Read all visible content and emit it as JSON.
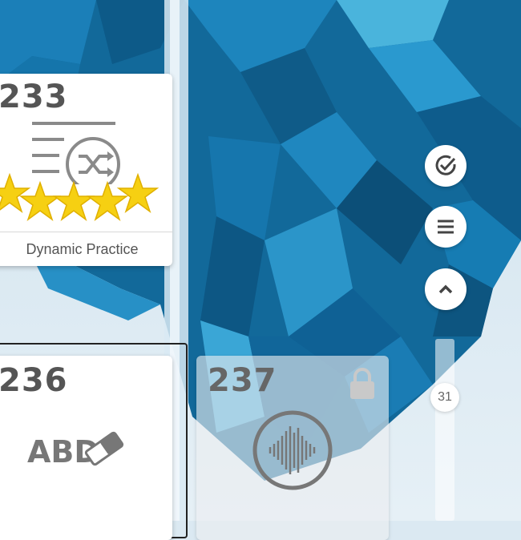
{
  "cards": [
    {
      "number": "233",
      "label": "Dynamic Practice",
      "icon": "shuffle-list-icon",
      "stars": 5,
      "locked": false
    },
    {
      "number": "236",
      "label": "",
      "icon": "abc-eraser-icon",
      "locked": false
    },
    {
      "number": "237",
      "label": "",
      "icon": "audio-wave-icon",
      "locked": true
    }
  ],
  "abc_text": "ABD",
  "sidebar": {
    "buttons": [
      "check-circle-icon",
      "menu-icon",
      "chevron-up-icon"
    ],
    "scroll_position": "31"
  },
  "colors": {
    "star": "#f6d012",
    "ice_dark": "#0d5a86",
    "ice_light": "#2a9fd6"
  }
}
